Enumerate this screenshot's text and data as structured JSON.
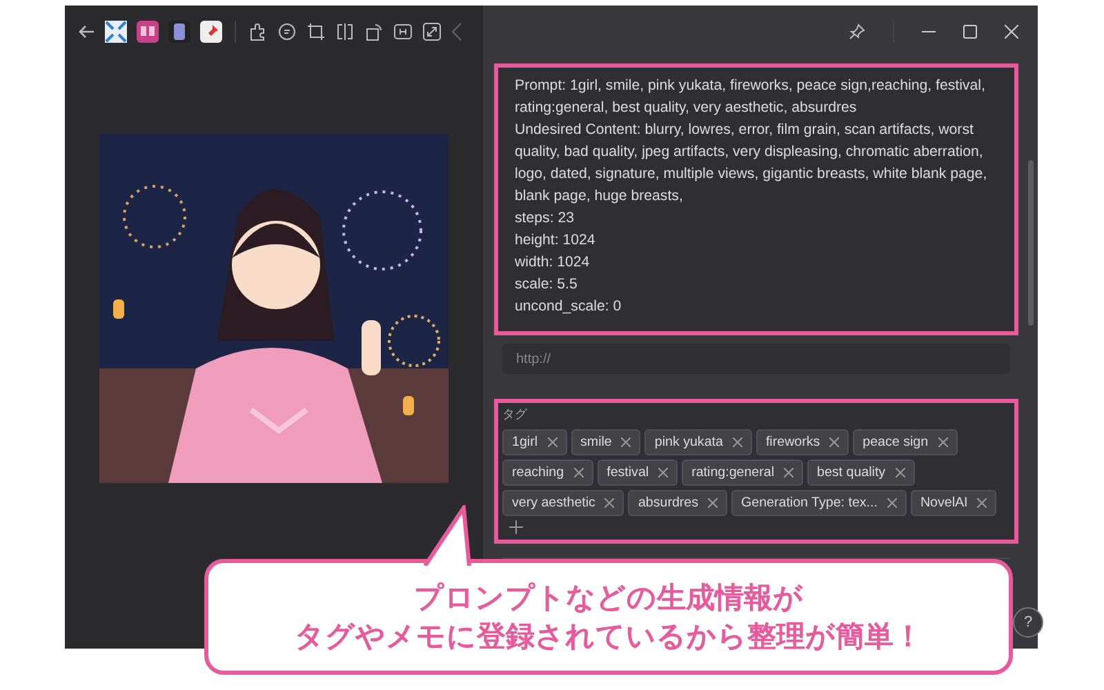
{
  "prompt_info": {
    "lines": [
      "Prompt: 1girl, smile, pink yukata, fireworks,  peace sign,reaching,  festival, rating:general, best quality, very aesthetic, absurdres",
      "Undesired Content: blurry, lowres, error, film grain, scan artifacts, worst quality, bad quality, jpeg artifacts, very displeasing, chromatic aberration, logo, dated, signature, multiple views, gigantic breasts, white blank page, blank page, huge breasts,",
      "steps: 23",
      "height: 1024",
      "width: 1024",
      "scale: 5.5",
      "uncond_scale: 0"
    ]
  },
  "url_field": {
    "placeholder": "http://"
  },
  "tags": {
    "label": "タグ",
    "items": [
      {
        "label": "1girl"
      },
      {
        "label": "smile"
      },
      {
        "label": "pink yukata"
      },
      {
        "label": "fireworks"
      },
      {
        "label": "peace sign"
      },
      {
        "label": "reaching"
      },
      {
        "label": "festival"
      },
      {
        "label": "rating:general"
      },
      {
        "label": "best quality"
      },
      {
        "label": "very aesthetic"
      },
      {
        "label": "absurdres"
      },
      {
        "label": "Generation Type: tex..."
      },
      {
        "label": "NovelAI"
      }
    ]
  },
  "help_button": {
    "label": "?"
  },
  "callout": {
    "lines": [
      "プロンプトなどの生成情報が",
      "タグやメモに登録されているから整理が簡単！"
    ]
  }
}
